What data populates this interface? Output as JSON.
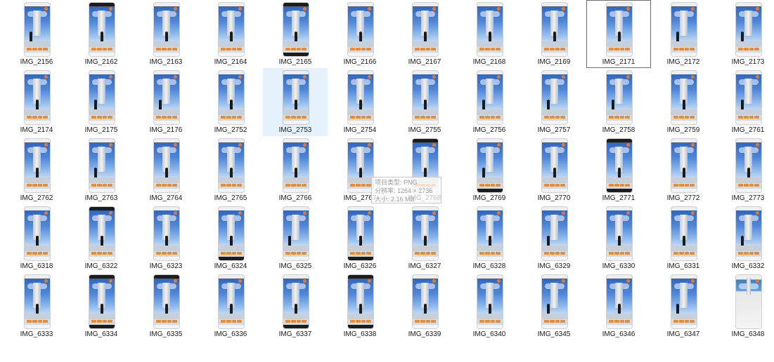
{
  "explorer": {
    "files": [
      "IMG_2156",
      "IMG_2162",
      "IMG_2163",
      "IMG_2164",
      "IMG_2165",
      "IMG_2166",
      "IMG_2167",
      "IMG_2168",
      "IMG_2169",
      "IMG_2171",
      "IMG_2172",
      "IMG_2173",
      "IMG_2174",
      "IMG_2175",
      "IMG_2176",
      "IMG_2752",
      "IMG_2753",
      "IMG_2754",
      "IMG_2755",
      "IMG_2756",
      "IMG_2757",
      "IMG_2758",
      "IMG_2759",
      "IMG_2761",
      "IMG_2762",
      "IMG_2763",
      "IMG_2764",
      "IMG_2765",
      "IMG_2766",
      "IMG_2767",
      "IMG_2768",
      "IMG_2769",
      "IMG_2770",
      "IMG_2771",
      "IMG_2772",
      "IMG_2773",
      "IMG_6318",
      "IMG_6322",
      "IMG_6323",
      "IMG_6324",
      "IMG_6325",
      "IMG_6326",
      "IMG_6327",
      "IMG_6328",
      "IMG_6329",
      "IMG_6330",
      "IMG_6331",
      "IMG_6332",
      "IMG_6333",
      "IMG_6334",
      "IMG_6335",
      "IMG_6336",
      "IMG_6337",
      "IMG_6338",
      "IMG_6339",
      "IMG_6340",
      "IMG_6345",
      "IMG_6346",
      "IMG_6347",
      "IMG_6348"
    ],
    "selected_file": "IMG_2753",
    "focused_file": "IMG_2171",
    "tooltip": {
      "type_line": "项目类型: PNG",
      "resolution_line": "分辨率: 1264 × 2736",
      "size_line": "大小: 2.16 MB"
    },
    "colors": {
      "selection": "#e5f1fb",
      "focus_border": "#6e6e6e",
      "button_orange": "#f08b2c"
    }
  }
}
